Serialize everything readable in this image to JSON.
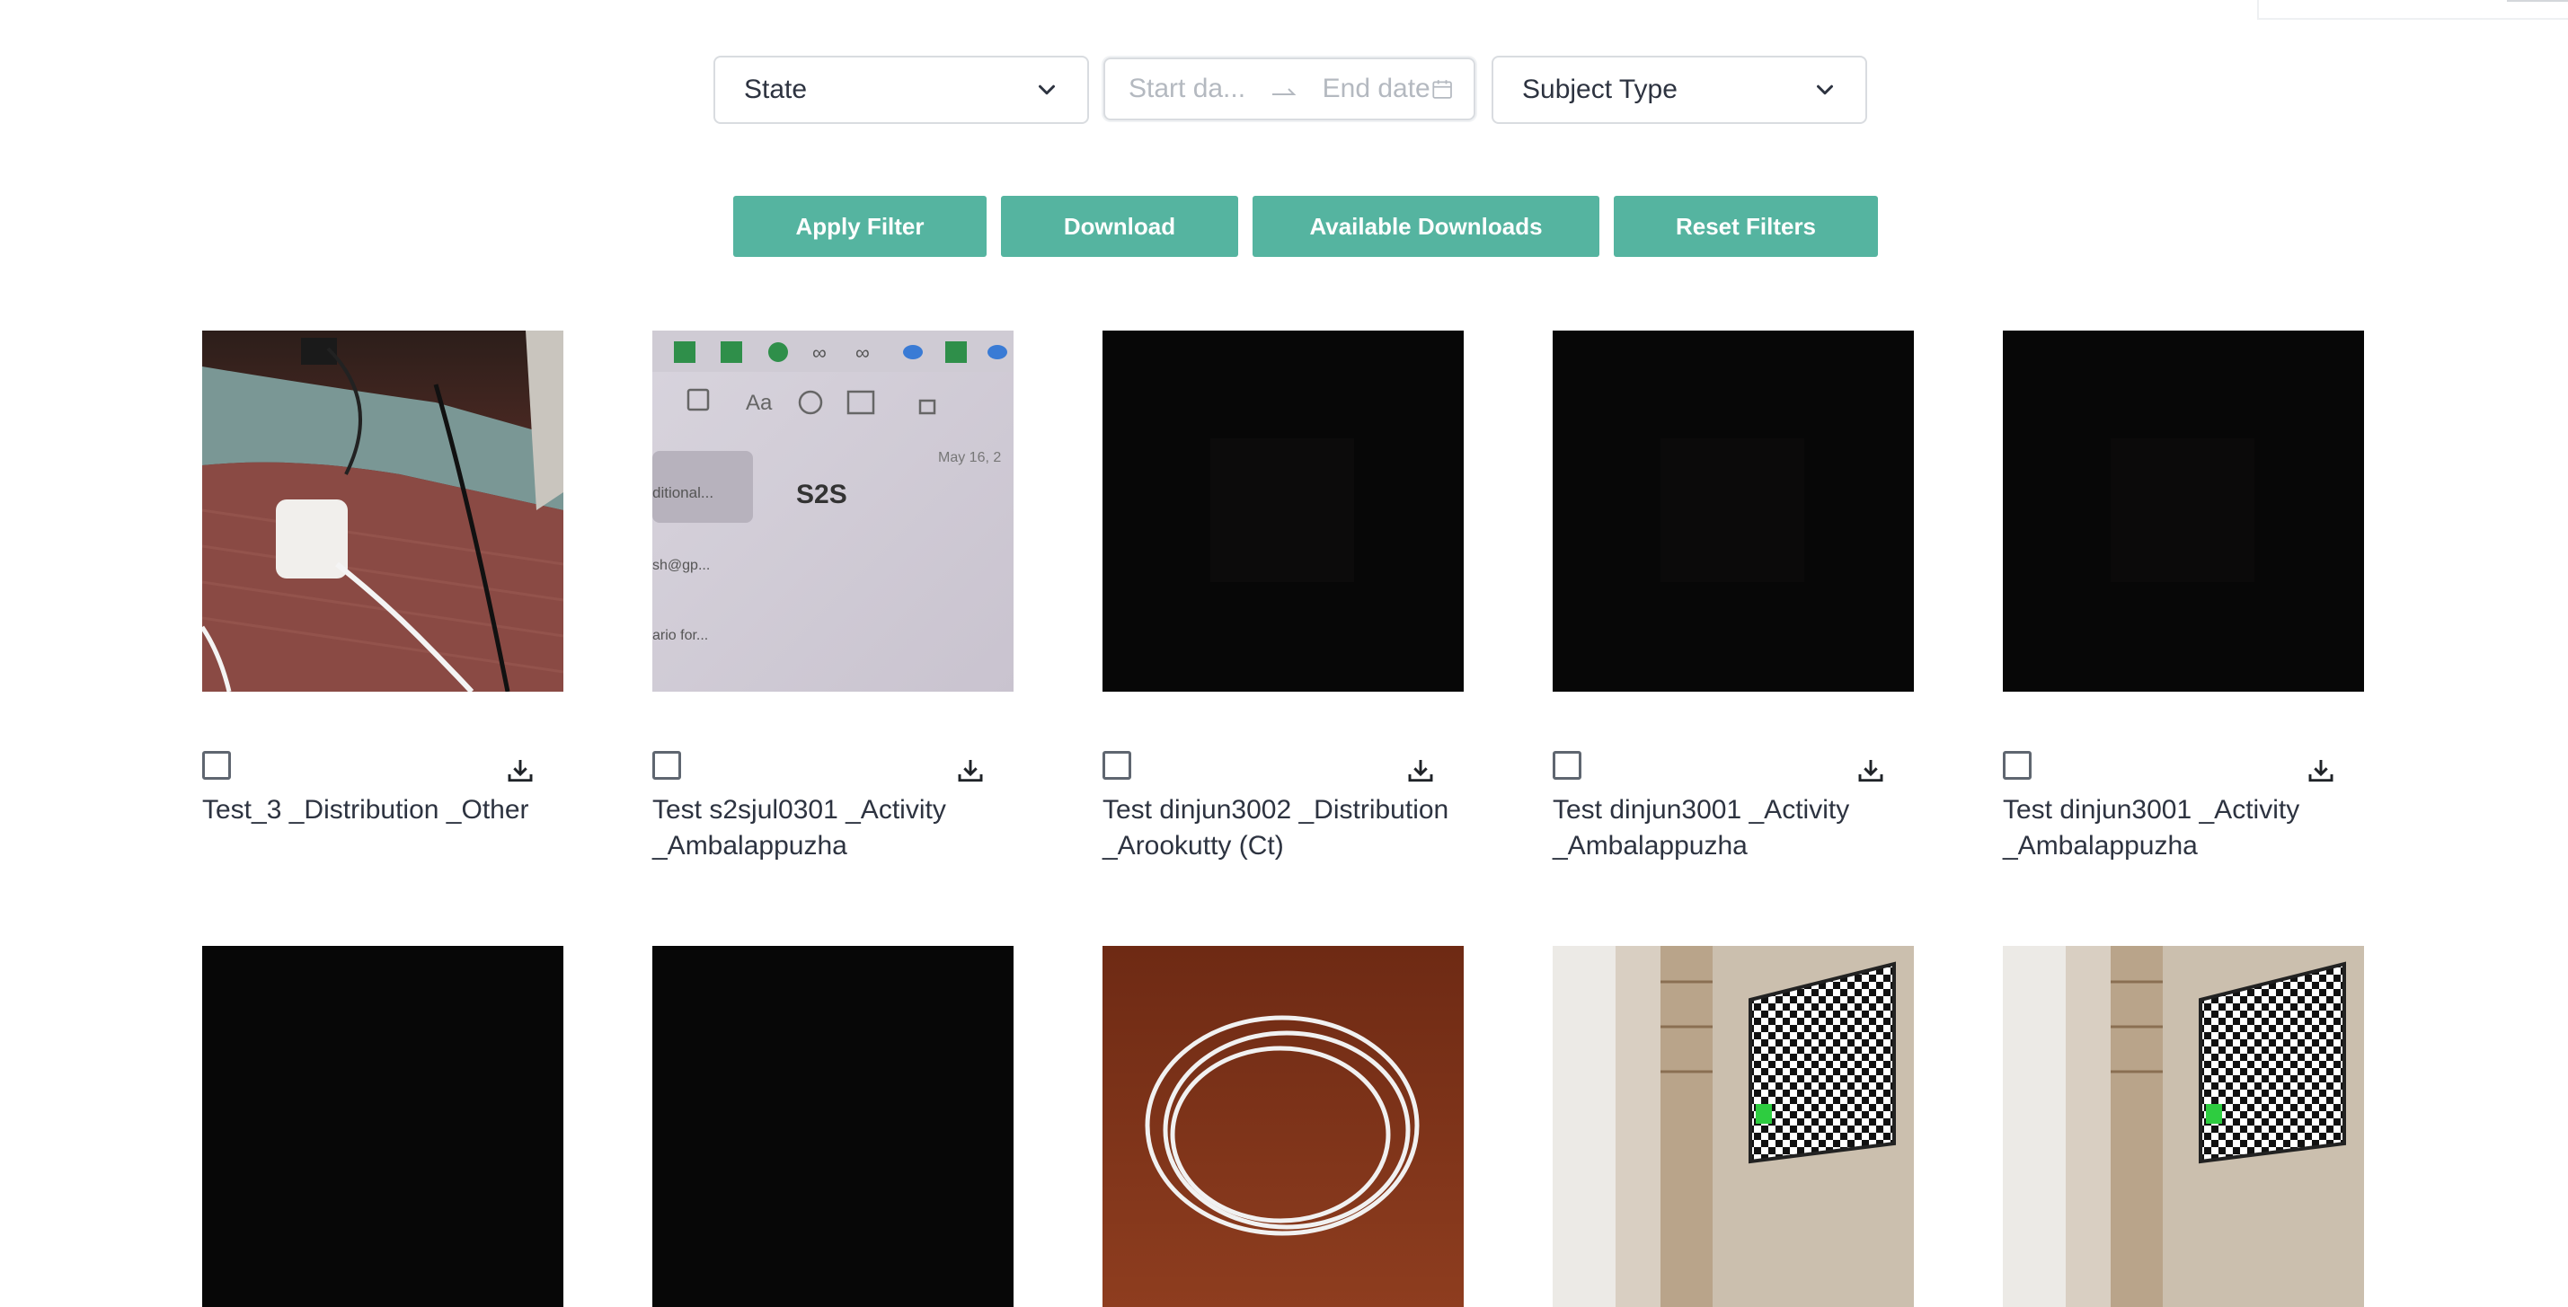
{
  "filters": {
    "state_label": "State",
    "start_date_placeholder": "Start da...",
    "end_date_placeholder": "End date",
    "subject_type_label": "Subject Type"
  },
  "actions": {
    "apply_filter": "Apply Filter",
    "download": "Download",
    "available_downloads": "Available Downloads",
    "reset_filters": "Reset Filters"
  },
  "thumb_texts": {
    "s2s": "S2S",
    "date": "May 16, 2",
    "aa": "Aa",
    "additional": "ditional...",
    "email": "sh@gp...",
    "scenario": "ario for..."
  },
  "cards": [
    {
      "caption": "Test_3 _Distribution _Other",
      "image": "charger-photo"
    },
    {
      "caption": "Test s2sjul0301 _Activity\n_Ambalappuzha",
      "image": "screen-photo-s2s"
    },
    {
      "caption": "Test dinjun3002 _Distribution\n_Arookutty (Ct)",
      "image": "dark-photo"
    },
    {
      "caption": "Test dinjun3001 _Activity\n_Ambalappuzha",
      "image": "dark-photo"
    },
    {
      "caption": "Test dinjun3001 _Activity\n_Ambalappuzha",
      "image": "dark-photo"
    },
    {
      "caption": "",
      "image": "dark-photo"
    },
    {
      "caption": "",
      "image": "dark-photo"
    },
    {
      "caption": "",
      "image": "cable-photo"
    },
    {
      "caption": "",
      "image": "checkerboard-room-photo"
    },
    {
      "caption": "",
      "image": "checkerboard-room-photo"
    }
  ],
  "colors": {
    "button_bg": "#55b4a0",
    "button_text": "#ffffff",
    "border": "#d9dce0",
    "text": "#2d3340",
    "placeholder": "#b4b9c0"
  }
}
